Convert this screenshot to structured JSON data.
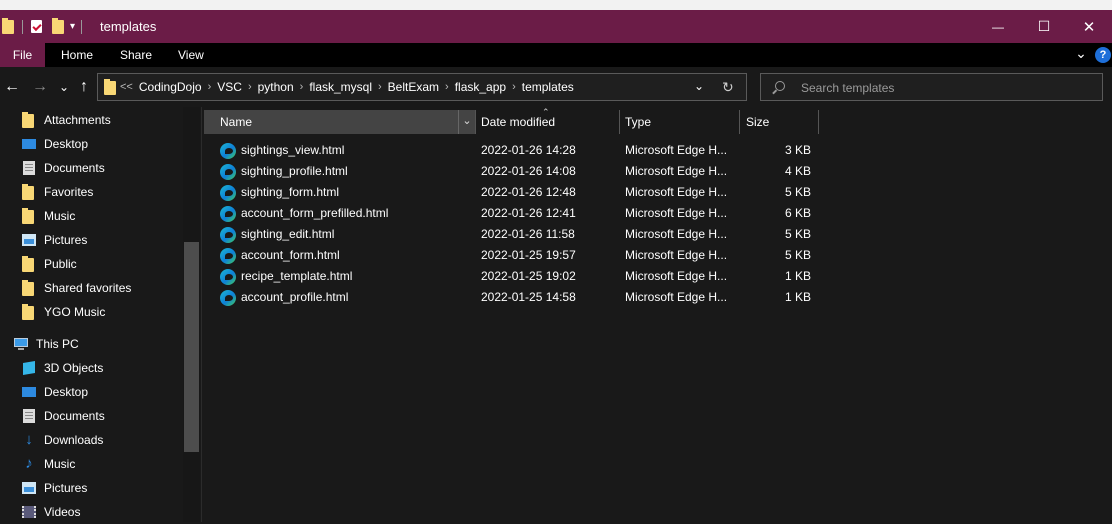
{
  "window": {
    "title": "templates",
    "minimize_glyph": "—",
    "maximize_glyph": "☐",
    "close_glyph": "✕"
  },
  "ribbon": {
    "tabs": [
      "File",
      "Home",
      "Share",
      "View"
    ],
    "expand_glyph": "⌄",
    "help_glyph": "?"
  },
  "address": {
    "back_glyph": "←",
    "forward_glyph": "→",
    "recent_glyph": "⌄",
    "up_glyph": "↑",
    "overflow": "<<",
    "crumbs": [
      "CodingDojo",
      "VSC",
      "python",
      "flask_mysql",
      "BeltExam",
      "flask_app",
      "templates"
    ],
    "refresh_glyph": "↻",
    "dropdown_glyph": "⌄"
  },
  "search": {
    "placeholder": "Search templates",
    "icon": "search-icon"
  },
  "sidebar": {
    "quick_items": [
      "Attachments",
      "Desktop",
      "Documents",
      "Favorites",
      "Music",
      "Pictures",
      "Public",
      "Shared favorites",
      "YGO Music"
    ],
    "this_pc_label": "This PC",
    "pc_items": [
      "3D Objects",
      "Desktop",
      "Documents",
      "Downloads",
      "Music",
      "Pictures",
      "Videos"
    ]
  },
  "columns": {
    "name": "Name",
    "date": "Date modified",
    "type": "Type",
    "size": "Size"
  },
  "files": [
    {
      "name": "sightings_view.html",
      "date": "2022-01-26 14:28",
      "type": "Microsoft Edge H...",
      "size": "3 KB"
    },
    {
      "name": "sighting_profile.html",
      "date": "2022-01-26 14:08",
      "type": "Microsoft Edge H...",
      "size": "4 KB"
    },
    {
      "name": "sighting_form.html",
      "date": "2022-01-26 12:48",
      "type": "Microsoft Edge H...",
      "size": "5 KB"
    },
    {
      "name": "account_form_prefilled.html",
      "date": "2022-01-26 12:41",
      "type": "Microsoft Edge H...",
      "size": "6 KB"
    },
    {
      "name": "sighting_edit.html",
      "date": "2022-01-26 11:58",
      "type": "Microsoft Edge H...",
      "size": "5 KB"
    },
    {
      "name": "account_form.html",
      "date": "2022-01-25 19:57",
      "type": "Microsoft Edge H...",
      "size": "5 KB"
    },
    {
      "name": "recipe_template.html",
      "date": "2022-01-25 19:02",
      "type": "Microsoft Edge H...",
      "size": "1 KB"
    },
    {
      "name": "account_profile.html",
      "date": "2022-01-25 14:58",
      "type": "Microsoft Edge H...",
      "size": "1 KB"
    }
  ]
}
